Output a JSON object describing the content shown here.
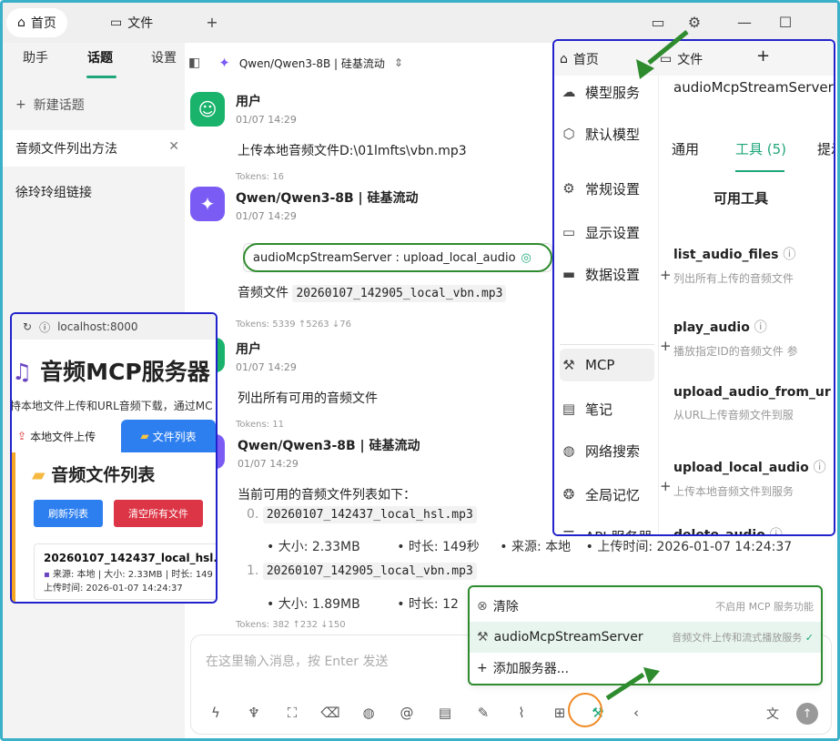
{
  "topbar": {
    "tabs": [
      {
        "label": "首页",
        "icon": "home-icon"
      },
      {
        "label": "文件",
        "icon": "folder-icon"
      }
    ],
    "add_tab": "+"
  },
  "sidebar": {
    "tabs": [
      "助手",
      "话题",
      "设置"
    ],
    "new_topic": "新建话题",
    "topics": [
      "音频文件列出方法",
      "徐玲玲组链接"
    ]
  },
  "chat": {
    "model_label": "Qwen/Qwen3-8B | 硅基流动",
    "messages": [
      {
        "role": "user",
        "name": "用户",
        "time": "01/07 14:29",
        "text": "上传本地音频文件D:\\01lmfts\\vbn.mp3",
        "tokens": "Tokens: 16"
      },
      {
        "role": "bot",
        "name": "Qwen/Qwen3-8B | 硅基流动",
        "time": "01/07 14:29",
        "tool_call": "audioMcpStreamServer : upload_local_audio",
        "text_prefix": "音频文件",
        "code": "20260107_142905_local_vbn.mp3",
        "tokens": "Tokens: 5339 ↑5263 ↓76"
      },
      {
        "role": "user",
        "name": "用户",
        "time": "01/07 14:29",
        "text": "列出所有可用的音频文件",
        "tokens": "Tokens: 11"
      },
      {
        "role": "bot",
        "name": "Qwen/Qwen3-8B | 硅基流动",
        "time": "01/07 14:29",
        "intro": "当前可用的音频文件列表如下：",
        "tokens": "Tokens: 382 ↑232 ↓150"
      }
    ],
    "files": [
      {
        "index": "0.",
        "name": "20260107_142437_local_hsl.mp3",
        "size": "大小: 2.33MB",
        "duration": "时长: 149秒",
        "source": "来源: 本地",
        "upload": "上传时间: 2026-01-07 14:24:37"
      },
      {
        "index": "1.",
        "name": "20260107_142905_local_vbn.mp3",
        "size": "大小: 1.89MB",
        "duration": "时长: 12"
      }
    ],
    "input_placeholder": "在这里输入消息，按 Enter 发送"
  },
  "browser": {
    "url": "localhost:8000",
    "title": "音频MCP服务器",
    "subtitle": "持本地文件上传和URL音频下载，通过MC",
    "tabs": [
      "本地文件上传",
      "文件列表"
    ],
    "panel_title": "音频文件列表",
    "refresh_btn": "刷新列表",
    "clear_btn": "清空所有文件",
    "card_name": "20260107_142437_local_hsl.mp3",
    "card_meta": "来源: 本地 | 大小: 2.33MB | 时长: 149",
    "card_time": "上传时间: 2026-01-07 14:24:37"
  },
  "settings": {
    "tabs": [
      "首页",
      "文件"
    ],
    "menu": [
      "模型服务",
      "默认模型",
      "常规设置",
      "显示设置",
      "数据设置",
      "MCP",
      "笔记",
      "网络搜索",
      "全局记忆",
      "API 服务器"
    ],
    "server_name": "audioMcpStreamServer",
    "subtabs": [
      "通用",
      "工具 (5)",
      "提示"
    ],
    "available_tools": "可用工具",
    "tools": [
      {
        "name": "list_audio_files",
        "desc": "列出所有上传的音频文件"
      },
      {
        "name": "play_audio",
        "desc": "播放指定ID的音频文件 参"
      },
      {
        "name": "upload_audio_from_ur",
        "desc": "从URL上传音频文件到服"
      },
      {
        "name": "upload_local_audio",
        "desc": "上传本地音频文件到服务"
      },
      {
        "name": "delete_audio",
        "desc": ""
      }
    ]
  },
  "mcp_popup": {
    "clear": "清除",
    "clear_note": "不启用 MCP 服务功能",
    "server": "audioMcpStreamServer",
    "server_note": "音频文件上传和流式播放服务",
    "add": "添加服务器..."
  },
  "colors": {
    "accent_green": "#1fa67a",
    "highlight_blue": "#2222cc",
    "highlight_green": "#2e8b2e",
    "orange": "#f08a24"
  }
}
